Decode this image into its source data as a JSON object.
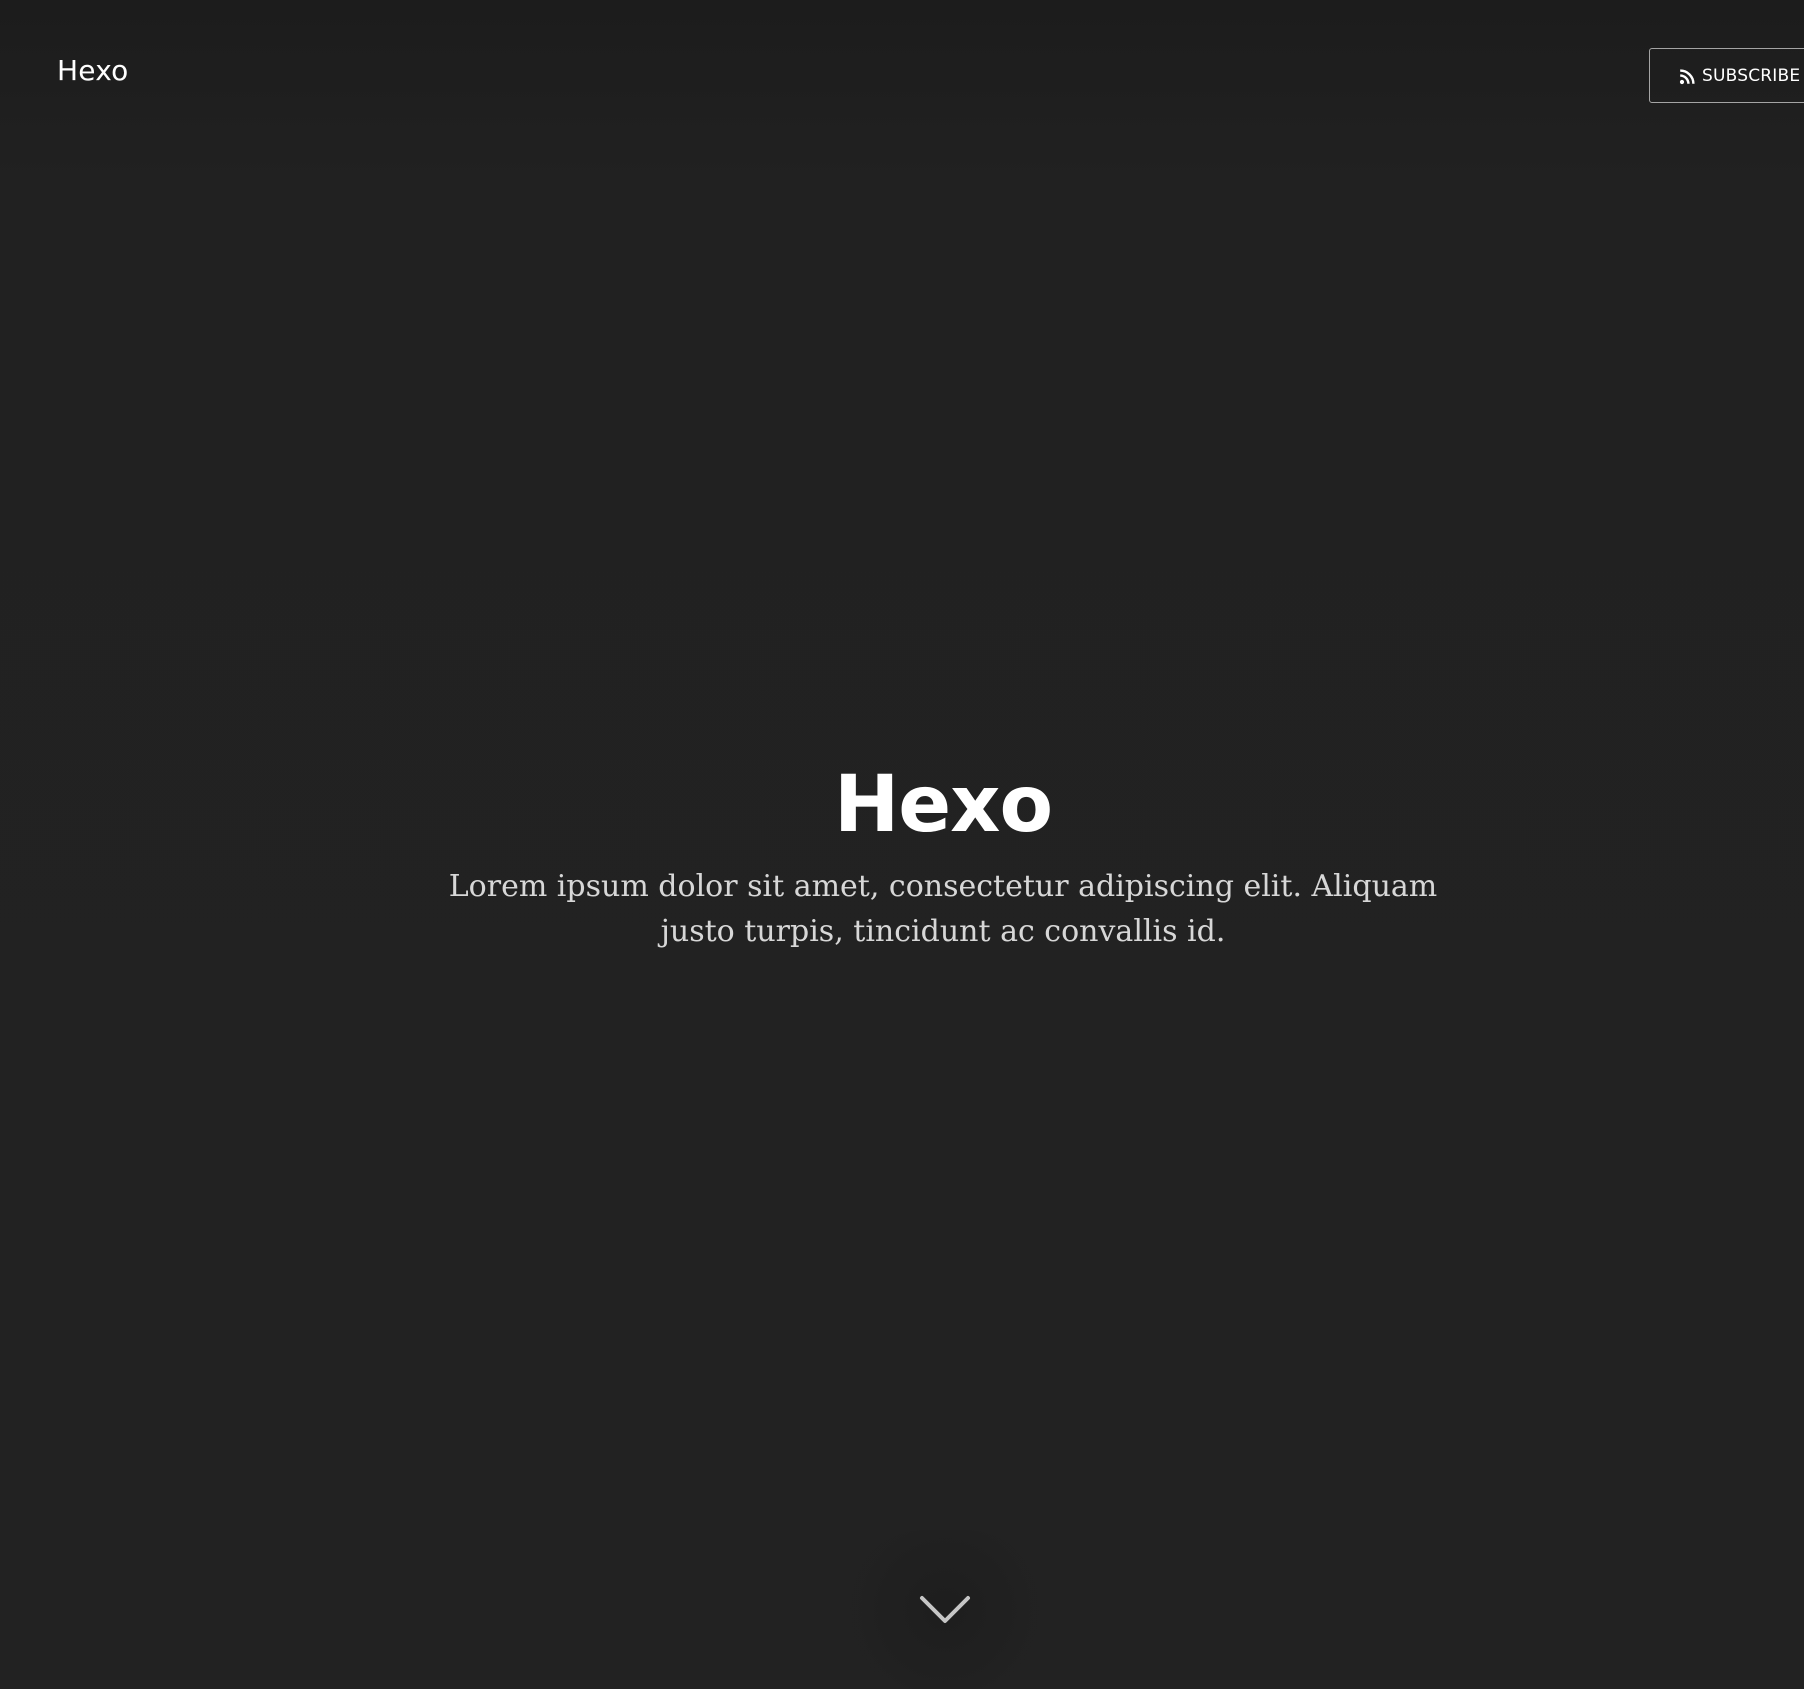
{
  "nav": {
    "logo": "Hexo",
    "subscribe_label": "SUBSCRIBE",
    "subscribe_icon": "rss-icon"
  },
  "hero": {
    "title": "Hexo",
    "description": "Lorem ipsum dolor sit amet, consectetur adipiscing elit. Aliquam justo turpis, tincidunt ac convallis id."
  },
  "scroll": {
    "icon": "chevron-down-icon"
  },
  "colors": {
    "background": "#222222",
    "text": "#ffffff"
  }
}
